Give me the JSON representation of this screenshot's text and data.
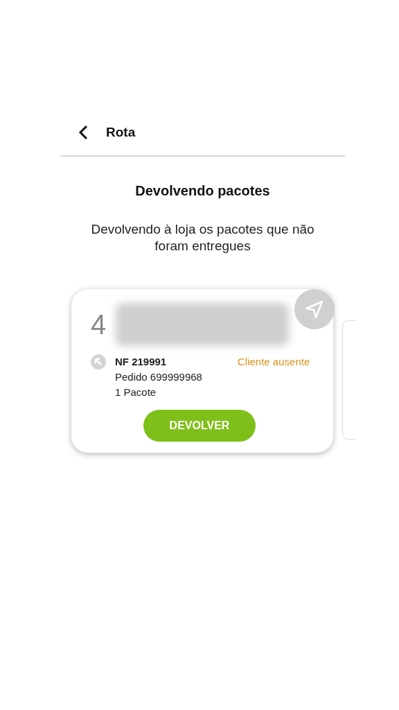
{
  "header": {
    "title": "Rota"
  },
  "title": "Devolvendo pacotes",
  "subtitle": "Devolvendo à loja os pacotes que não foram entregues",
  "cards": [
    {
      "number": "4",
      "invoice": "NF 219991",
      "order": "Pedido 699999968",
      "packages": "1 Pacote",
      "status": "Cliente ausente",
      "button": "DEVOLVER"
    }
  ]
}
